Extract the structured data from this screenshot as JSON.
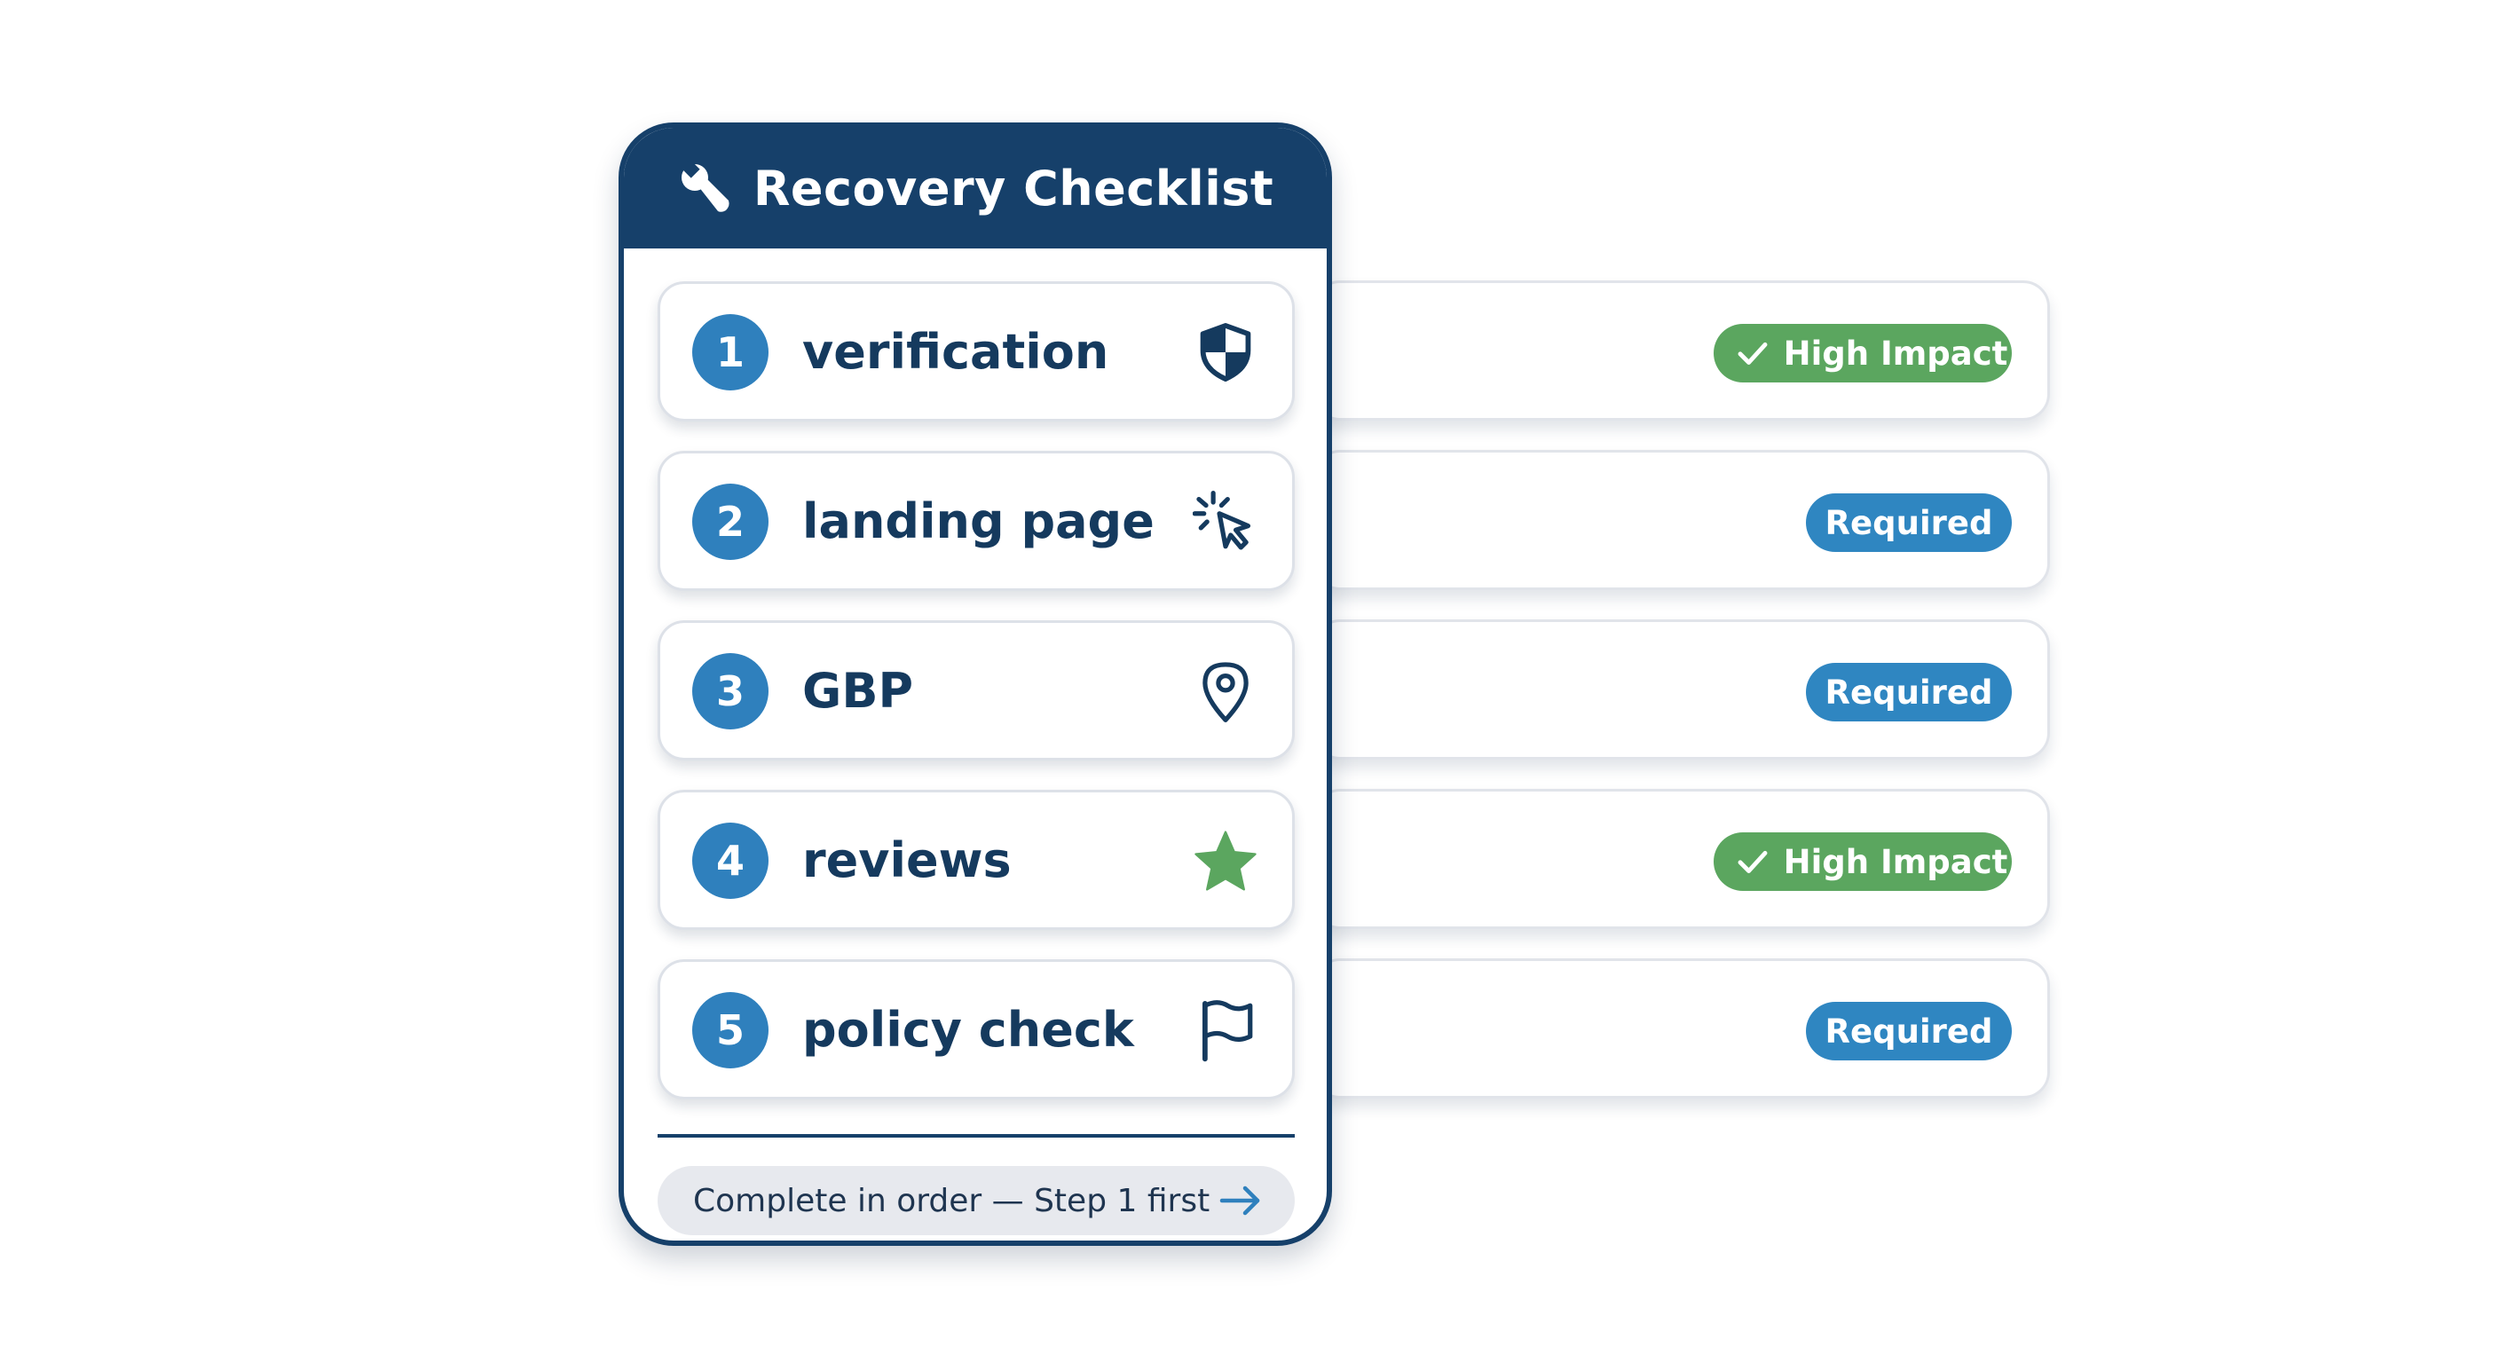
{
  "card": {
    "title": "Recovery Checklist",
    "title_icon": "wrench-icon",
    "steps": [
      {
        "number": "1",
        "label": "verification",
        "icon": "shield-icon",
        "badge": "High Impact",
        "badge_type": "high"
      },
      {
        "number": "2",
        "label": "landing page",
        "icon": "cursor-click-icon",
        "badge": "Required",
        "badge_type": "required"
      },
      {
        "number": "3",
        "label": "GBP",
        "icon": "map-pin-icon",
        "badge": "Required",
        "badge_type": "required"
      },
      {
        "number": "4",
        "label": "reviews",
        "icon": "star-icon",
        "badge": "High Impact",
        "badge_type": "high"
      },
      {
        "number": "5",
        "label": "policy check",
        "icon": "flag-icon",
        "badge": "Required",
        "badge_type": "required"
      }
    ],
    "footer": {
      "text": "Complete in order — Step 1 first",
      "icon": "arrow-right-icon"
    }
  },
  "colors": {
    "header": "#16406a",
    "step_number": "#2f80bd",
    "high_impact": "#5ba65f",
    "required": "#2f86c1",
    "star": "#5ba65f"
  }
}
